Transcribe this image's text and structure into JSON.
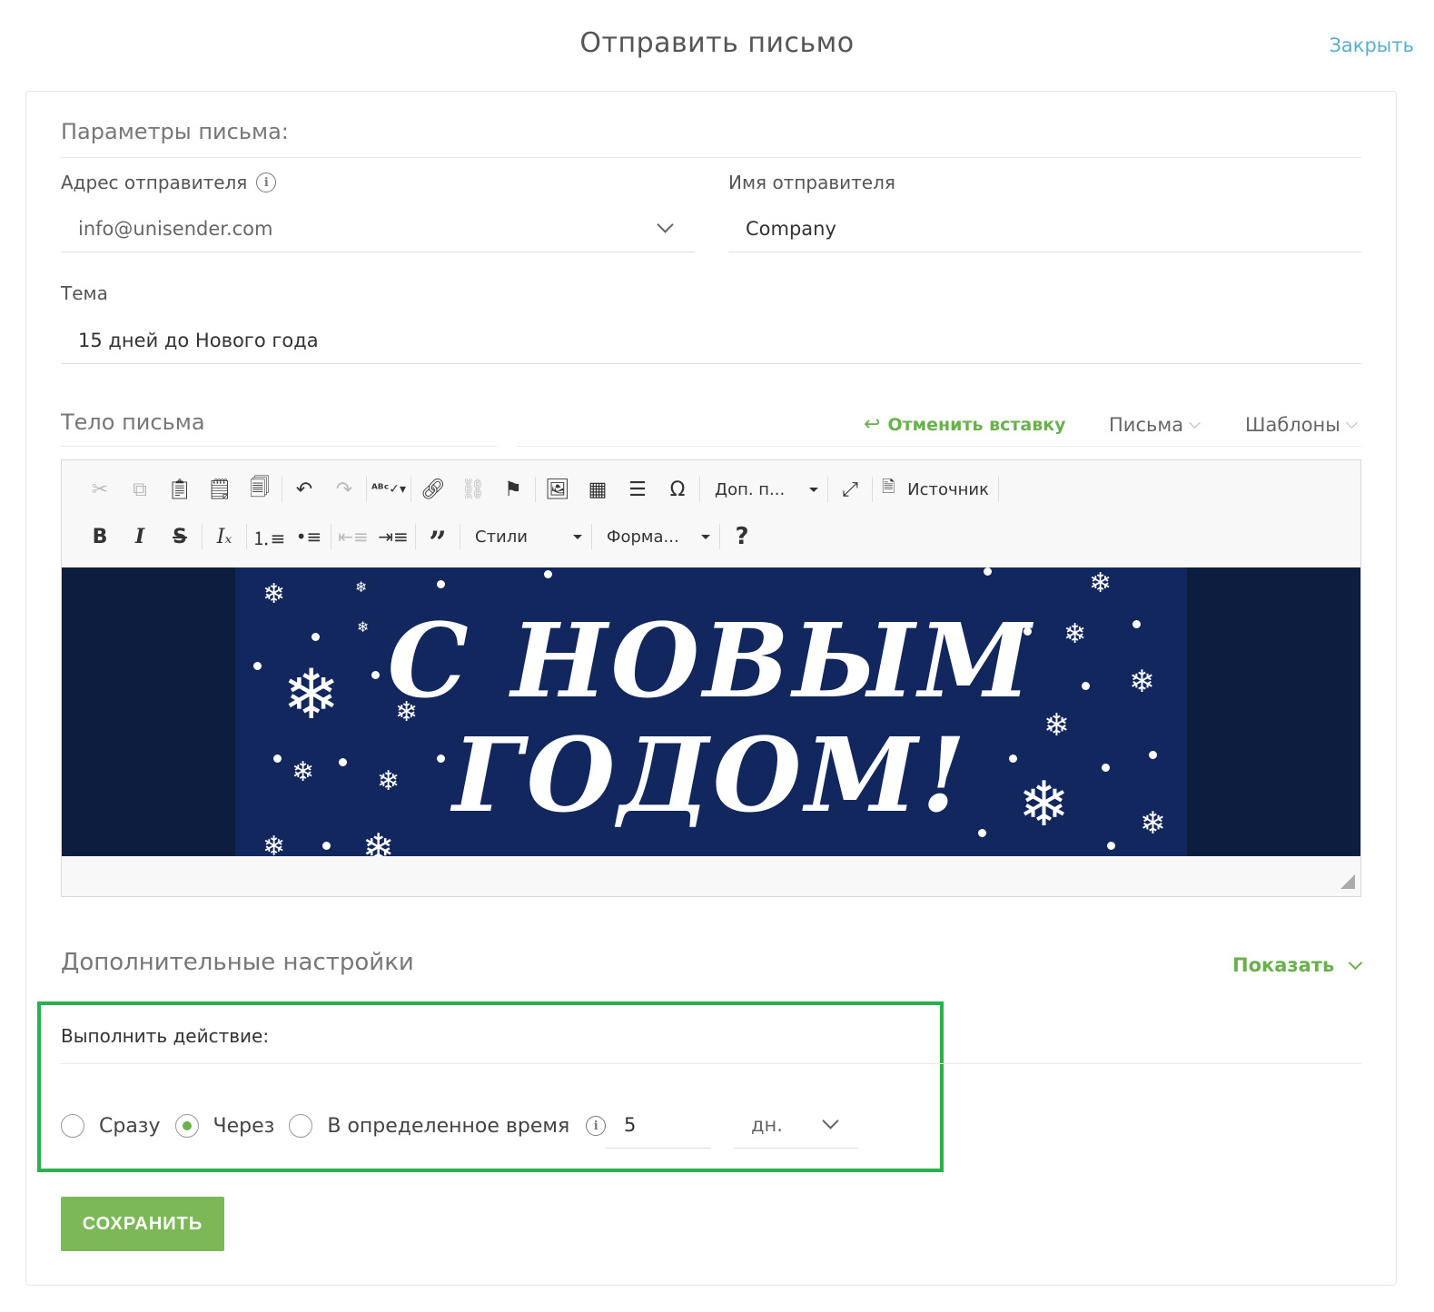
{
  "header": {
    "title": "Отправить письмо",
    "close_label": "Закрыть"
  },
  "params": {
    "section_title": "Параметры письма:",
    "sender_address_label": "Адрес отправителя",
    "sender_address_value": "info@unisender.com",
    "sender_name_label": "Имя отправителя",
    "sender_name_value": "Company",
    "subject_label": "Тема",
    "subject_value": "15 дней до Нового года"
  },
  "body": {
    "section_title": "Тело письма",
    "undo_paste_label": "Отменить вставку",
    "letters_label": "Письма",
    "templates_label": "Шаблоны"
  },
  "editor": {
    "more_combo": "Доп. п...",
    "source_label": "Источник",
    "styles_combo": "Стили",
    "format_combo": "Форма...",
    "help": "?"
  },
  "banner": {
    "line1": "С НОВЫМ",
    "line2": "ГОДОМ!"
  },
  "extra": {
    "section_title": "Дополнительные настройки",
    "show_label": "Показать"
  },
  "action": {
    "title": "Выполнить действие:",
    "option_now": "Сразу",
    "option_after": "Через",
    "option_at_time": "В определенное время",
    "delay_value": "5",
    "unit_value": "дн.",
    "selected": "after"
  },
  "save_label": "СОХРАНИТЬ",
  "colors": {
    "accent_green": "#6ab04c",
    "link_blue": "#5aaeca",
    "highlight_green": "#2bb04b",
    "banner_navy": "#12275e"
  }
}
